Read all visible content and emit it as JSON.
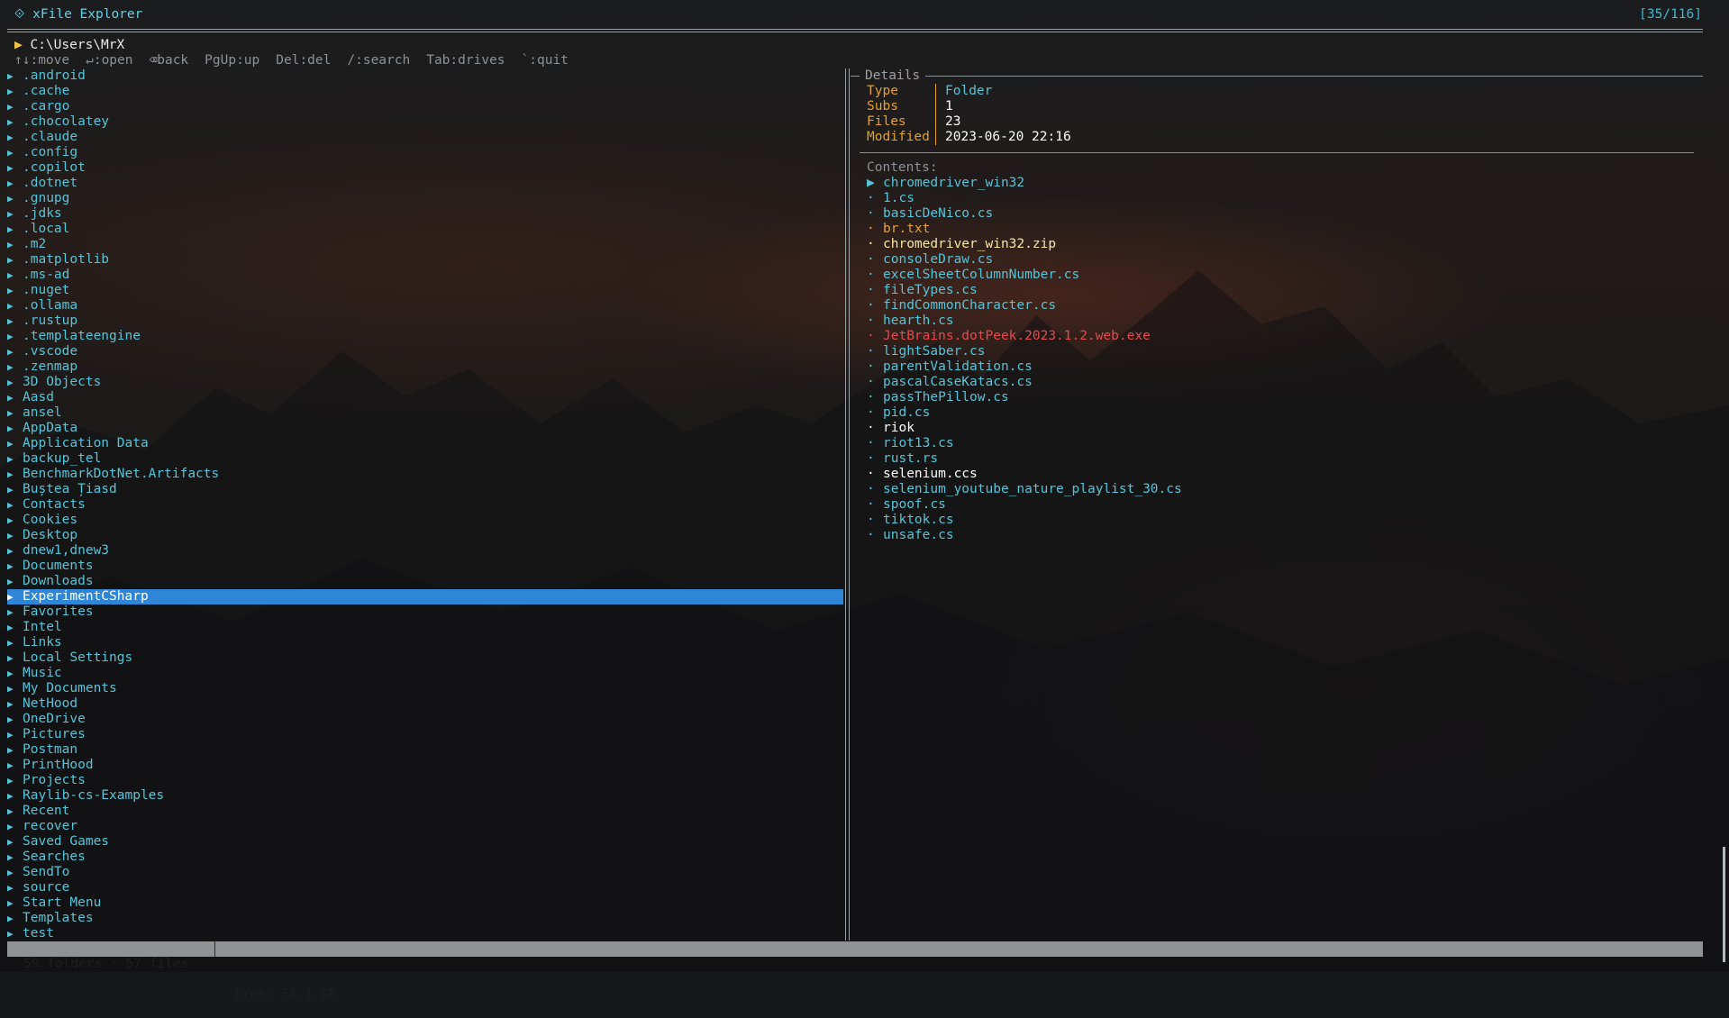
{
  "app": {
    "title": "⟐ xFile Explorer",
    "counter": "[35/116]"
  },
  "path": {
    "arrow": "▶",
    "value": "C:\\Users\\MrX"
  },
  "keys": [
    "↑↓:move",
    "↵:open",
    "⌫back",
    "PgUp:up",
    "Del:del",
    "/:search",
    "Tab:drives",
    "`:quit"
  ],
  "folders": [
    ".android",
    ".cache",
    ".cargo",
    ".chocolatey",
    ".claude",
    ".config",
    ".copilot",
    ".dotnet",
    ".gnupg",
    ".jdks",
    ".local",
    ".m2",
    ".matplotlib",
    ".ms-ad",
    ".nuget",
    ".ollama",
    ".rustup",
    ".templateengine",
    ".vscode",
    ".zenmap",
    "3D Objects",
    "Aasd",
    "ansel",
    "AppData",
    "Application Data",
    "backup_tel",
    "BenchmarkDotNet.Artifacts",
    "Buștea Țiasd",
    "Contacts",
    "Cookies",
    "Desktop",
    "dnew1,dnew3",
    "Documents",
    "Downloads",
    "ExperimentCSharp",
    "Favorites",
    "Intel",
    "Links",
    "Local Settings",
    "Music",
    "My Documents",
    "NetHood",
    "OneDrive",
    "Pictures",
    "Postman",
    "PrintHood",
    "Projects",
    "Raylib-cs-Examples",
    "Recent",
    "recover",
    "Saved Games",
    "Searches",
    "SendTo",
    "source",
    "Start Menu",
    "Templates",
    "test"
  ],
  "selected_folder": "ExperimentCSharp",
  "details": {
    "title": "Details",
    "type_label": "Type",
    "type_value": "Folder",
    "subs_label": "Subs",
    "subs_value": "1",
    "files_label": "Files",
    "files_value": "23",
    "modified_label": "Modified",
    "modified_value": "2023-06-20 22:16"
  },
  "contents": {
    "label": "Contents:",
    "items": [
      {
        "bullet": "▶",
        "name": "chromedriver_win32",
        "color": "#56c4d8"
      },
      {
        "bullet": "·",
        "name": "1.cs",
        "color": "#56c4d8"
      },
      {
        "bullet": "·",
        "name": "basicDeNico.cs",
        "color": "#56c4d8"
      },
      {
        "bullet": "·",
        "name": "br.txt",
        "color": "#e3a12f"
      },
      {
        "bullet": "·",
        "name": "chromedriver_win32.zip",
        "color": "#f6e7a6"
      },
      {
        "bullet": "·",
        "name": "consoleDraw.cs",
        "color": "#56c4d8"
      },
      {
        "bullet": "·",
        "name": "excelSheetColumnNumber.cs",
        "color": "#56c4d8"
      },
      {
        "bullet": "·",
        "name": "fileTypes.cs",
        "color": "#56c4d8"
      },
      {
        "bullet": "·",
        "name": "findCommonCharacter.cs",
        "color": "#56c4d8"
      },
      {
        "bullet": "·",
        "name": "hearth.cs",
        "color": "#56c4d8"
      },
      {
        "bullet": "·",
        "name": "JetBrains.dotPeek.2023.1.2.web.exe",
        "color": "#e64a4f"
      },
      {
        "bullet": "·",
        "name": "lightSaber.cs",
        "color": "#56c4d8"
      },
      {
        "bullet": "·",
        "name": "parentValidation.cs",
        "color": "#56c4d8"
      },
      {
        "bullet": "·",
        "name": "pascalCaseKatacs.cs",
        "color": "#56c4d8"
      },
      {
        "bullet": "·",
        "name": "passThePillow.cs",
        "color": "#56c4d8"
      },
      {
        "bullet": "·",
        "name": "pid.cs",
        "color": "#56c4d8"
      },
      {
        "bullet": "·",
        "name": "riok",
        "color": "#ffffff"
      },
      {
        "bullet": "·",
        "name": "riot13.cs",
        "color": "#56c4d8"
      },
      {
        "bullet": "·",
        "name": "rust.rs",
        "color": "#56c4d8"
      },
      {
        "bullet": "·",
        "name": "selenium.ccs",
        "color": "#ffffff"
      },
      {
        "bullet": "·",
        "name": "selenium_youtube_nature_playlist_30.cs",
        "color": "#56c4d8"
      },
      {
        "bullet": "·",
        "name": "spoof.cs",
        "color": "#56c4d8"
      },
      {
        "bullet": "·",
        "name": "tiktok.cs",
        "color": "#56c4d8"
      },
      {
        "bullet": "·",
        "name": "unsafe.cs",
        "color": "#56c4d8"
      }
    ]
  },
  "status": {
    "counts": "59 folders · 57 files",
    "free": "Free: 56.1 GB"
  },
  "colors": {
    "accent": "#2f86d6",
    "folder": "#56c4d8",
    "label": "#e3a12f",
    "exe": "#e64a4f"
  }
}
